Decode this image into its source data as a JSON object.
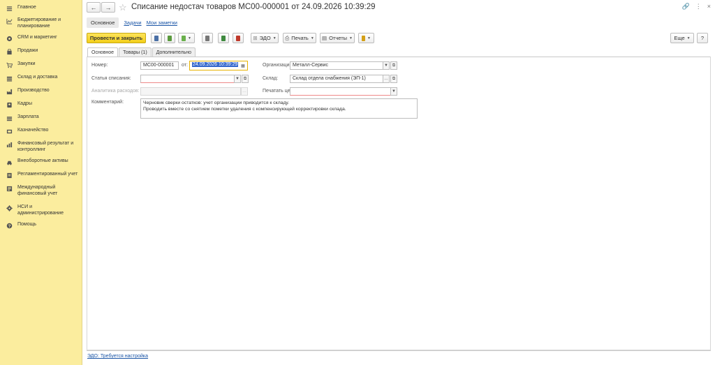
{
  "sidebar": {
    "items": [
      {
        "label": "Главное",
        "icon": "menu-icon"
      },
      {
        "label": "Бюджетирование и планирование",
        "icon": "chart-icon"
      },
      {
        "label": "CRM и маркетинг",
        "icon": "crm-icon"
      },
      {
        "label": "Продажи",
        "icon": "bag-icon"
      },
      {
        "label": "Закупки",
        "icon": "cart-icon"
      },
      {
        "label": "Склад и доставка",
        "icon": "warehouse-icon"
      },
      {
        "label": "Производство",
        "icon": "factory-icon"
      },
      {
        "label": "Кадры",
        "icon": "people-icon"
      },
      {
        "label": "Зарплата",
        "icon": "salary-icon"
      },
      {
        "label": "Казначейство",
        "icon": "treasury-icon"
      },
      {
        "label": "Финансовый результат и контроллинг",
        "icon": "finance-icon"
      },
      {
        "label": "Внеоборотные активы",
        "icon": "assets-icon"
      },
      {
        "label": "Регламентированный учет",
        "icon": "ledger-icon"
      },
      {
        "label": "Международный финансовый учет",
        "icon": "international-icon"
      },
      {
        "label": "НСИ и администрирование",
        "icon": "gear-icon"
      },
      {
        "label": "Помощь",
        "icon": "help-icon"
      }
    ]
  },
  "header": {
    "title": "Списание недостач товаров МС00-000001 от 24.09.2026 10:39:29",
    "back": "←",
    "forward": "→",
    "link_icon": "🔗",
    "more_icon": "⋮",
    "close_icon": "×"
  },
  "navlinks": {
    "main": "Основное",
    "tasks": "Задачи",
    "notes": "Мои заметки"
  },
  "toolbar": {
    "post_close": "Провести и закрыть",
    "edo": "ЭДО",
    "print": "Печать",
    "reports": "Отчеты",
    "more": "Еще",
    "help": "?"
  },
  "tabs": [
    "Основное",
    "Товары (1)",
    "Дополнительно"
  ],
  "form": {
    "number_label": "Номер:",
    "number_value": "МС00-000001",
    "date_label": "от:",
    "date_value": "24.09.2026 10:39:29",
    "org_label": "Организация:",
    "org_value": "Металл-Сервис",
    "article_label": "Статья списания:",
    "article_value": "",
    "warehouse_label": "Склад:",
    "warehouse_value": "Склад отдела снабжения (ЭП-1)",
    "analytics_label": "Аналитика расходов:",
    "analytics_value": "",
    "print_prices_label": "Печатать цены:",
    "print_prices_value": "",
    "comment_label": "Комментарий:",
    "comment_line1": "Черновик сверки остатков: учет организации приводится к складу.",
    "comment_line2": "Проводить вместе со снятием пометки удаления с компенсирующей корректировки склада."
  },
  "footer": {
    "edo_link": "ЭДО: Требуется настройка"
  },
  "colors": {
    "sidebar_bg": "#fbed9e",
    "primary_btn": "#f3cf1a",
    "link": "#1a55a6"
  }
}
